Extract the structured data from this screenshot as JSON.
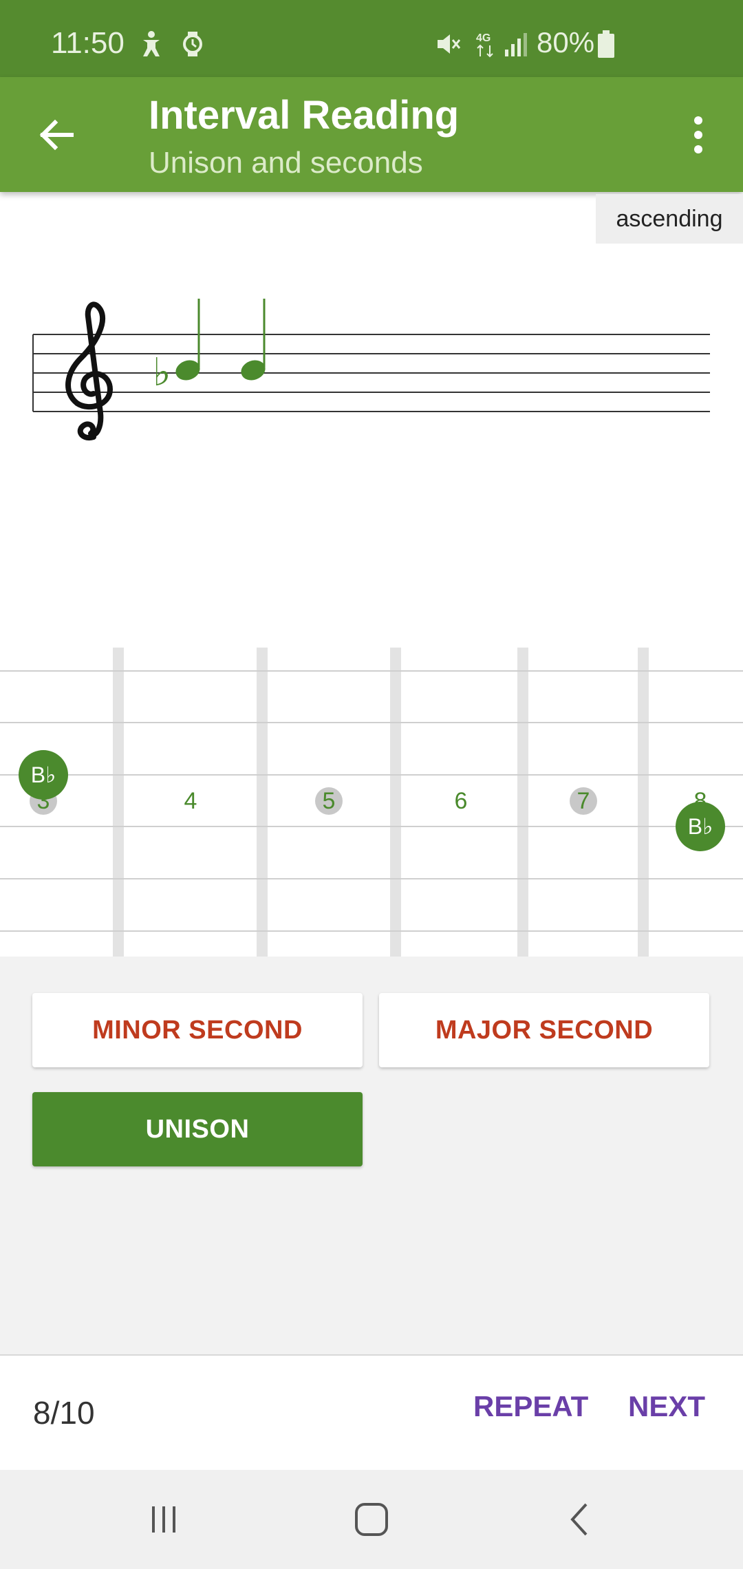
{
  "status_bar": {
    "time": "11:50",
    "battery": "80%",
    "icons": [
      "accessibility-icon",
      "watch-icon",
      "mute-icon",
      "4g-icon",
      "signal-icon",
      "battery-icon"
    ]
  },
  "toolbar": {
    "title": "Interval Reading",
    "subtitle": "Unison and seconds",
    "back_icon": "arrow-left-icon",
    "menu_icon": "more-vert-icon"
  },
  "direction": "ascending",
  "staff": {
    "clef": "treble",
    "accidental": "♭",
    "note_color": "#4b8a2d"
  },
  "fretboard": {
    "fret_labels": [
      {
        "label": "3",
        "marked": true
      },
      {
        "label": "4",
        "marked": false
      },
      {
        "label": "5",
        "marked": true
      },
      {
        "label": "6",
        "marked": false
      },
      {
        "label": "7",
        "marked": true
      },
      {
        "label": "8",
        "marked": false
      }
    ],
    "notes": [
      "B♭",
      "B♭"
    ]
  },
  "answers": {
    "minor_second": "MINOR SECOND",
    "major_second": "MAJOR SECOND",
    "unison": "UNISON"
  },
  "footer": {
    "progress": "8/10",
    "repeat": "REPEAT",
    "next": "NEXT"
  },
  "colors": {
    "status_bar": "#558b2f",
    "toolbar": "#689f38",
    "accent_green": "#4b8a2d",
    "answer_text": "#bf3b1e",
    "footer_action": "#6a3fa8"
  }
}
